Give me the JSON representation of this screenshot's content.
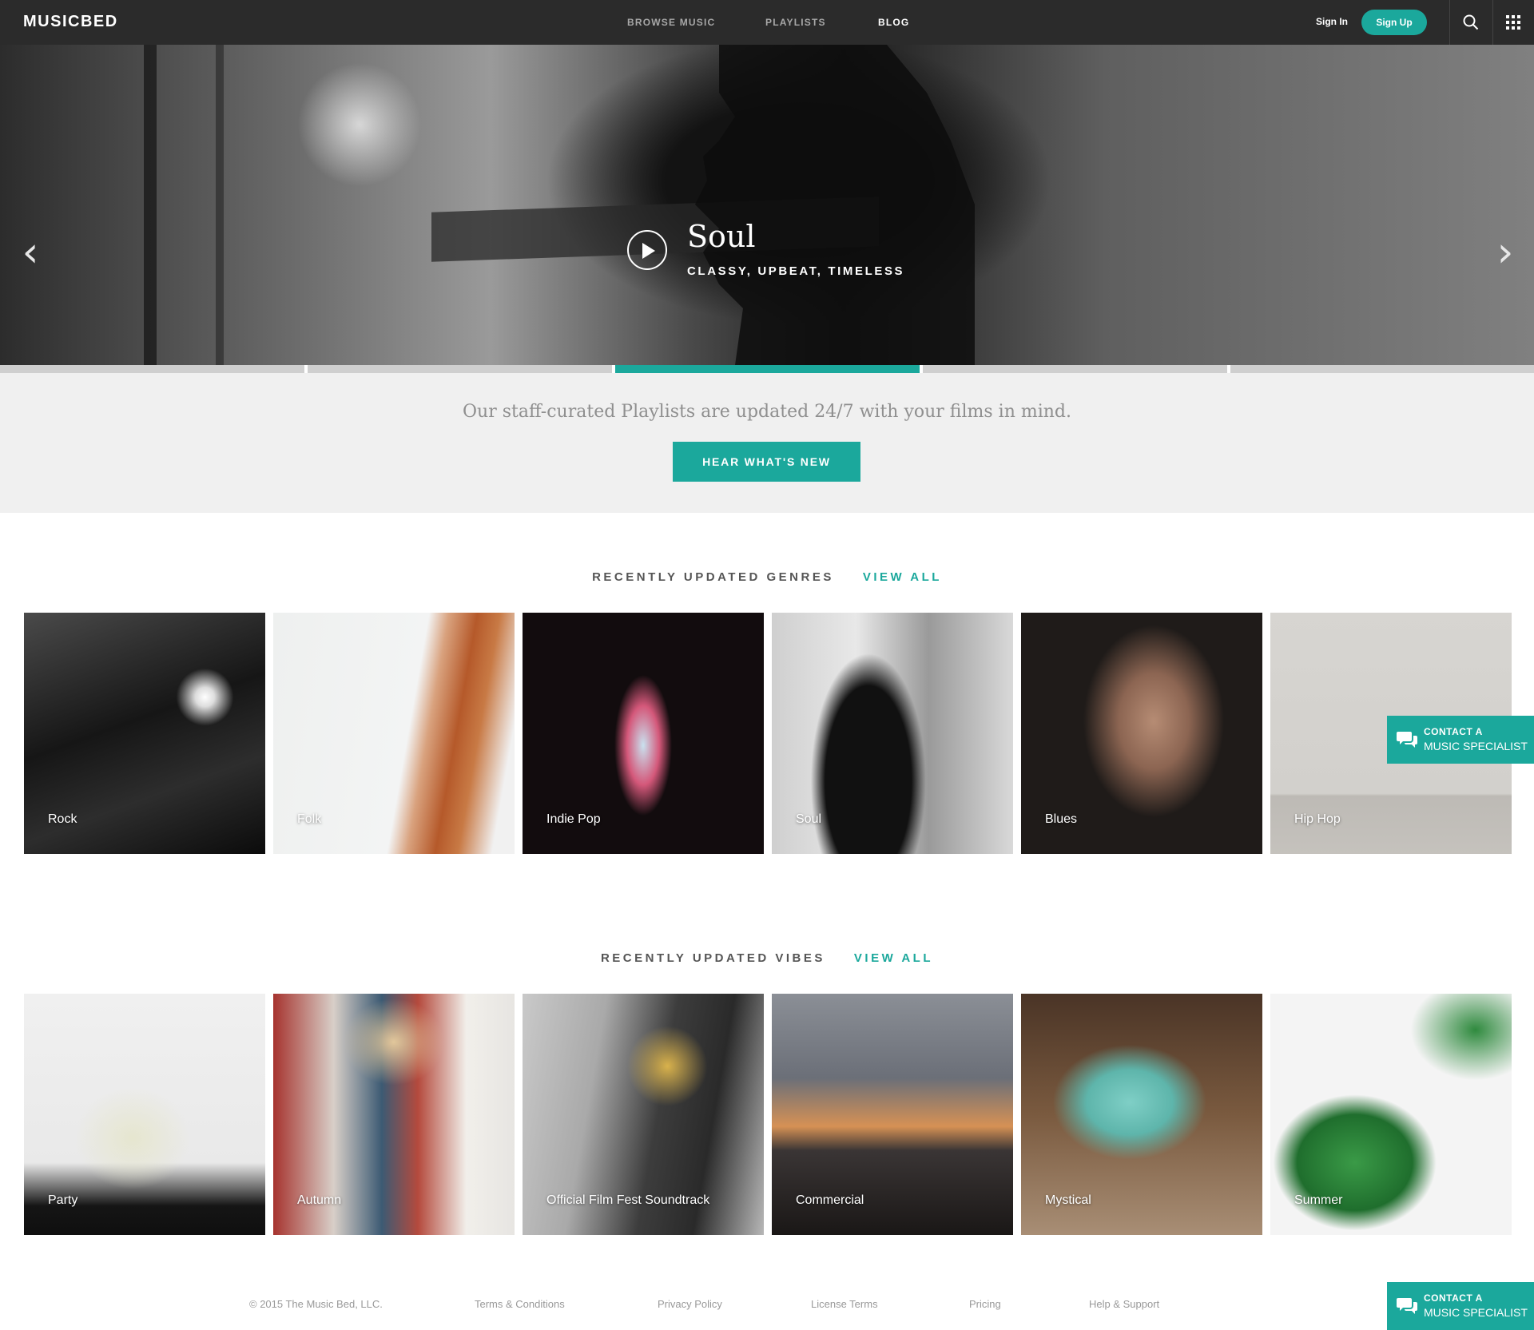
{
  "nav": {
    "logo": "MUSICBED",
    "links": [
      {
        "label": "BROWSE MUSIC"
      },
      {
        "label": "PLAYLISTS"
      },
      {
        "label": "BLOG"
      }
    ],
    "sign_in": "Sign In",
    "sign_up": "Sign Up",
    "icons": [
      "search-icon",
      "grid-menu-icon"
    ]
  },
  "hero": {
    "title": "Soul",
    "subtitle": "CLASSY, UPBEAT, TIMELESS",
    "active_slide": 3,
    "slide_count": 5
  },
  "promo": {
    "text": "Our staff-curated Playlists are updated 24/7 with your films in mind.",
    "button": "HEAR WHAT'S NEW"
  },
  "genres": {
    "heading": "RECENTLY UPDATED GENRES",
    "view_all": "VIEW ALL",
    "items": [
      "Rock",
      "Folk",
      "Indie Pop",
      "Soul",
      "Blues",
      "Hip Hop"
    ]
  },
  "vibes": {
    "heading": "RECENTLY UPDATED VIBES",
    "view_all": "VIEW ALL",
    "items": [
      "Party",
      "Autumn",
      "Official Film Fest Soundtrack",
      "Commercial",
      "Mystical",
      "Summer"
    ]
  },
  "contact": {
    "line1": "CONTACT A",
    "line2": "MUSIC SPECIALIST"
  },
  "footer": {
    "copyright": "© 2015 The Music Bed, LLC.",
    "links": [
      "Terms & Conditions",
      "Privacy Policy",
      "License Terms",
      "Pricing",
      "Help & Support"
    ]
  },
  "colors": {
    "accent": "#1ba89c",
    "nav_bg": "#2b2b2b",
    "promo_bg": "#f0f0f0"
  }
}
